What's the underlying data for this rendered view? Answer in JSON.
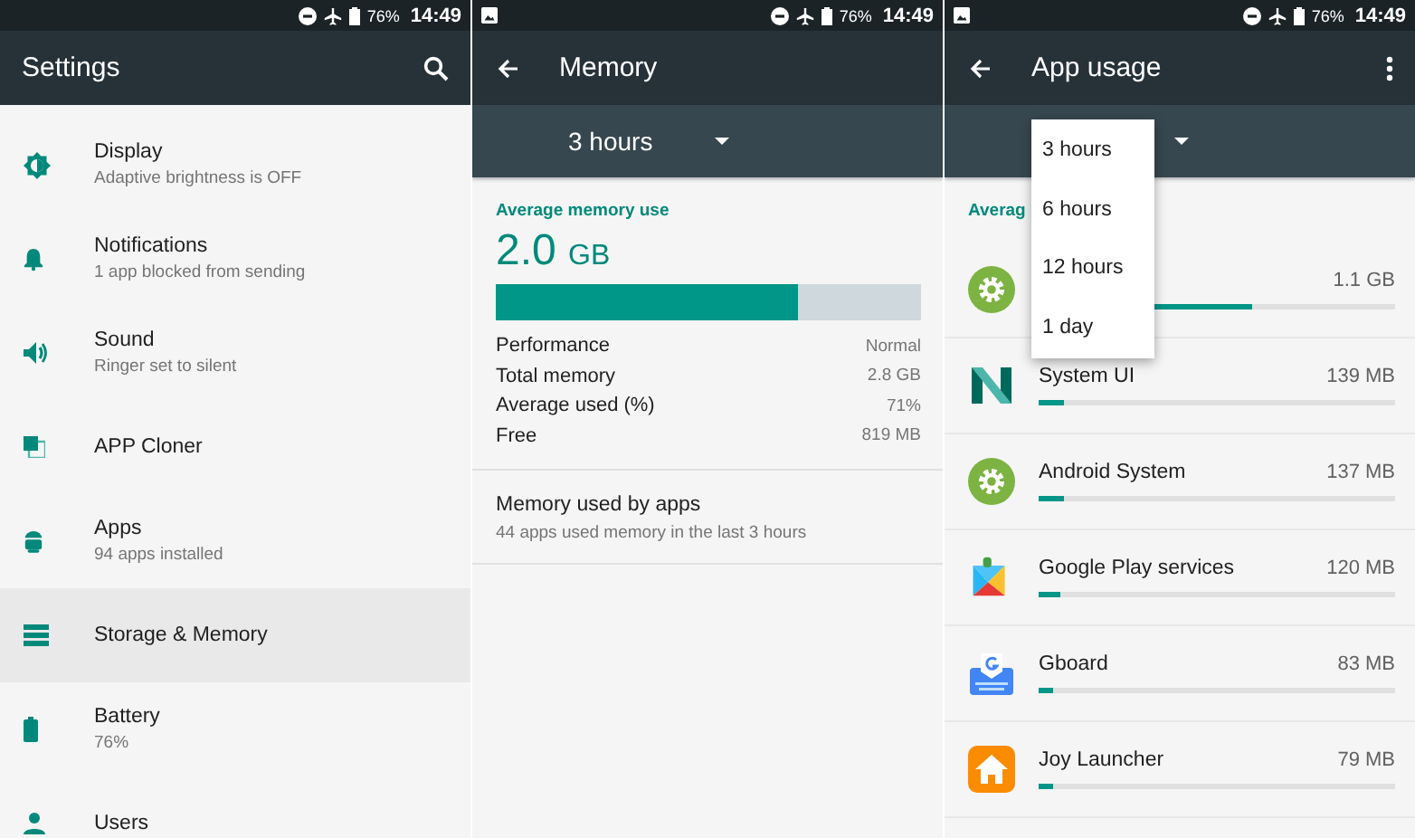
{
  "panels": [
    {
      "status_bar": {
        "show_image_icon": false,
        "battery": "76%",
        "time": "14:49"
      }
    },
    {
      "status_bar": {
        "show_image_icon": true,
        "battery": "76%",
        "time": "14:49"
      }
    },
    {
      "status_bar": {
        "show_image_icon": true,
        "battery": "76%",
        "time": "14:49"
      }
    }
  ],
  "settings": {
    "title": "Settings",
    "items": [
      {
        "title": "Display",
        "subtitle": "Adaptive brightness is OFF",
        "selected": false
      },
      {
        "title": "Notifications",
        "subtitle": "1 app blocked from sending",
        "selected": false
      },
      {
        "title": "Sound",
        "subtitle": "Ringer set to silent",
        "selected": false
      },
      {
        "title": "APP Cloner",
        "selected": false
      },
      {
        "title": "Apps",
        "subtitle": "94 apps installed",
        "selected": false
      },
      {
        "title": "Storage & Memory",
        "selected": true
      },
      {
        "title": "Battery",
        "subtitle": "76%",
        "selected": false
      },
      {
        "title": "Users",
        "selected": false
      }
    ]
  },
  "memory": {
    "title": "Memory",
    "period": "3 hours",
    "heading": "Average memory use",
    "amount": "2.0",
    "unit": "GB",
    "level": 0.71,
    "stats": [
      {
        "label": "Performance",
        "value": "Normal"
      },
      {
        "label": "Total memory",
        "value": "2.8 GB"
      },
      {
        "label": "Average used (%)",
        "value": "71%"
      },
      {
        "label": "Free",
        "value": "819 MB"
      }
    ],
    "apps_link": {
      "title": "Memory used by apps",
      "subtitle": "44 apps used memory in the last 3 hours"
    }
  },
  "app_usage": {
    "title": "App usage",
    "heading": "Averag",
    "dropdown": [
      {
        "label": "3 hours",
        "selected": false
      },
      {
        "label": "6 hours",
        "selected": false
      },
      {
        "label": "12 hours",
        "selected": false
      },
      {
        "label": "1 day",
        "selected": false
      }
    ],
    "apps": [
      {
        "value": "1.1 GB",
        "level": 0.6
      },
      {
        "name": "System UI",
        "value": "139 MB",
        "level": 0.07
      },
      {
        "name": "Android System",
        "value": "137 MB",
        "level": 0.07
      },
      {
        "name": "Google Play services",
        "value": "120 MB",
        "level": 0.06
      },
      {
        "name": "Gboard",
        "value": "83 MB",
        "level": 0.04
      },
      {
        "name": "Joy Launcher",
        "value": "79 MB",
        "level": 0.04
      }
    ]
  }
}
